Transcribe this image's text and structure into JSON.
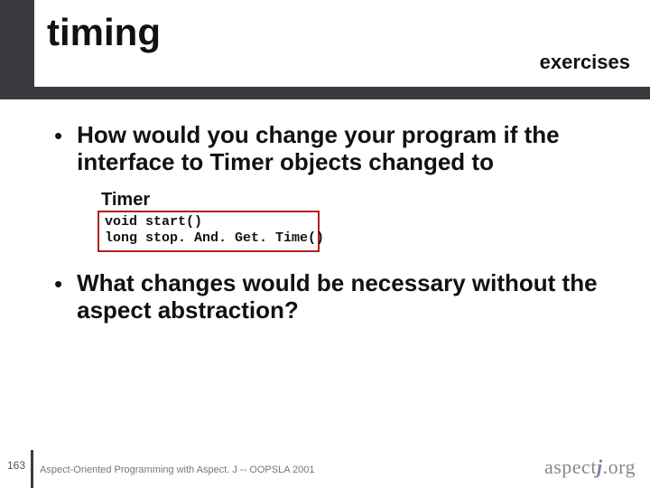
{
  "header": {
    "title": "timing",
    "subtitle": "exercises"
  },
  "bullets": [
    "How would you change your program if the interface to Timer objects changed to",
    "What changes would be necessary without the aspect abstraction?"
  ],
  "code": {
    "title": "Timer",
    "line1": "void start()",
    "line2": "long stop. And. Get. Time()"
  },
  "footer": {
    "page_number": "163",
    "caption": "Aspect-Oriented Programming with Aspect. J -- OOPSLA 2001",
    "logo_prefix": "aspect",
    "logo_j": "j",
    "logo_suffix": ".org"
  }
}
